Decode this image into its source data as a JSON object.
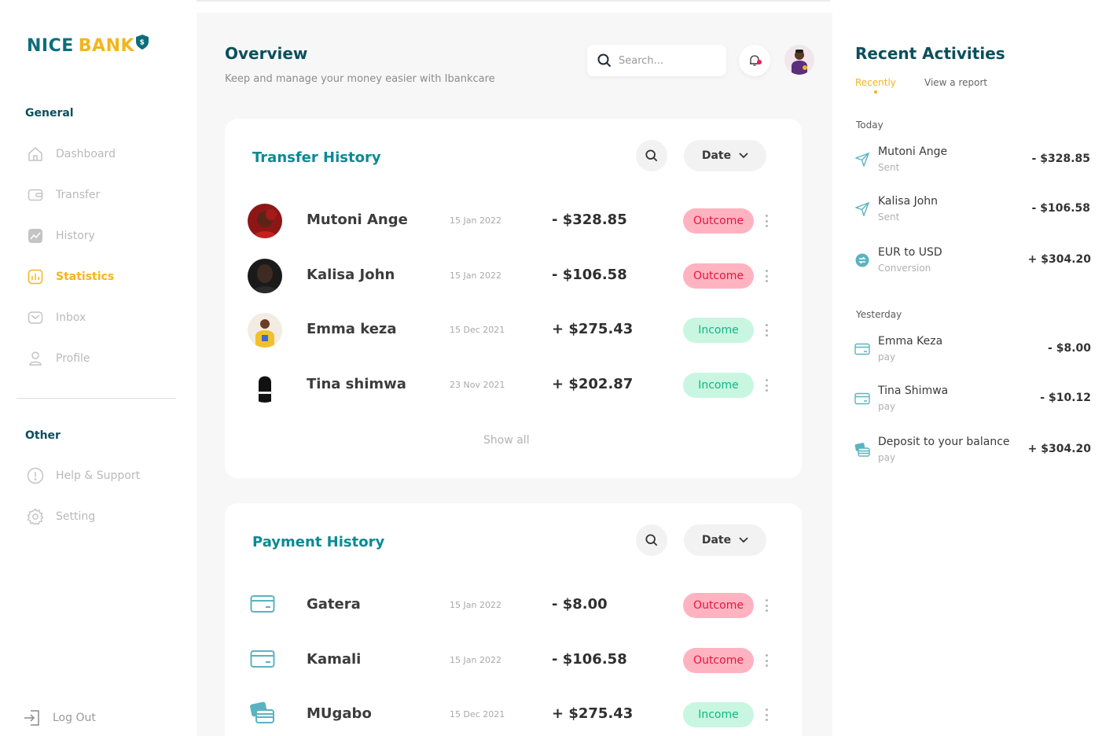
{
  "logo": {
    "word1": "NICE",
    "word2": "BANK",
    "badge": "$"
  },
  "sidebar": {
    "general_label": "General",
    "items": [
      {
        "label": "Dashboard",
        "icon": "home-icon"
      },
      {
        "label": "Transfer",
        "icon": "wallet-icon"
      },
      {
        "label": "History",
        "icon": "chart-line-icon"
      },
      {
        "label": "Statistics",
        "icon": "bar-chart-icon",
        "active": true
      },
      {
        "label": "Inbox",
        "icon": "mail-icon"
      },
      {
        "label": "Profile",
        "icon": "user-icon"
      }
    ],
    "other_label": "Other",
    "other_items": [
      {
        "label": "Help & Support",
        "icon": "info-icon"
      },
      {
        "label": "Setting",
        "icon": "gear-icon"
      }
    ],
    "logout_label": "Log Out"
  },
  "header": {
    "title": "Overview",
    "subtitle": "Keep and manage your money easier with Ibankcare",
    "search_placeholder": "Search..."
  },
  "transfer_history": {
    "title": "Transfer History",
    "filter_label": "Date",
    "show_all": "Show all",
    "rows": [
      {
        "name": "Mutoni Ange",
        "date": "15 Jan 2022",
        "amount": "- $328.85",
        "status": "Outcome"
      },
      {
        "name": "Kalisa John",
        "date": "15 Jan 2022",
        "amount": "- $106.58",
        "status": "Outcome"
      },
      {
        "name": "Emma keza",
        "date": "15 Dec 2021",
        "amount": "+ $275.43",
        "status": "Income"
      },
      {
        "name": "Tina shimwa",
        "date": "23 Nov 2021",
        "amount": "+ $202.87",
        "status": "Income"
      }
    ]
  },
  "payment_history": {
    "title": "Payment History",
    "filter_label": "Date",
    "rows": [
      {
        "name": "Gatera",
        "date": "15 Jan 2022",
        "amount": "- $8.00",
        "status": "Outcome",
        "icon": "credit-card-icon"
      },
      {
        "name": "Kamali",
        "date": "15 Jan 2022",
        "amount": "- $106.58",
        "status": "Outcome",
        "icon": "credit-card-icon"
      },
      {
        "name": "MUgabo",
        "date": "15 Dec 2021",
        "amount": "+ $275.43",
        "status": "Income",
        "icon": "cards-stack-icon"
      }
    ]
  },
  "recent": {
    "title": "Recent Activities",
    "tab_active": "Recently",
    "tab_other": "View a report",
    "today_label": "Today",
    "yesterday_label": "Yesterday",
    "today": [
      {
        "title": "Mutoni Ange",
        "sub": "Sent",
        "amount": "- $328.85",
        "icon": "send-icon"
      },
      {
        "title": "Kalisa John",
        "sub": "Sent",
        "amount": "- $106.58",
        "icon": "send-icon"
      },
      {
        "title": "EUR to USD",
        "sub": "Conversion",
        "amount": "+ $304.20",
        "icon": "exchange-icon"
      }
    ],
    "yesterday": [
      {
        "title": "Emma Keza",
        "sub": "pay",
        "amount": "- $8.00",
        "icon": "credit-card-icon"
      },
      {
        "title": "Tina Shimwa",
        "sub": "pay",
        "amount": "- $10.12",
        "icon": "credit-card-icon"
      },
      {
        "title": "Deposit to your balance",
        "sub": "pay",
        "amount": "+ $304.20",
        "icon": "cards-stack-icon"
      }
    ]
  },
  "colors": {
    "brand_teal": "#0b6e7a",
    "brand_yellow": "#f2b51d",
    "outcome_red": "#e9143e",
    "income_green": "#12b783"
  }
}
